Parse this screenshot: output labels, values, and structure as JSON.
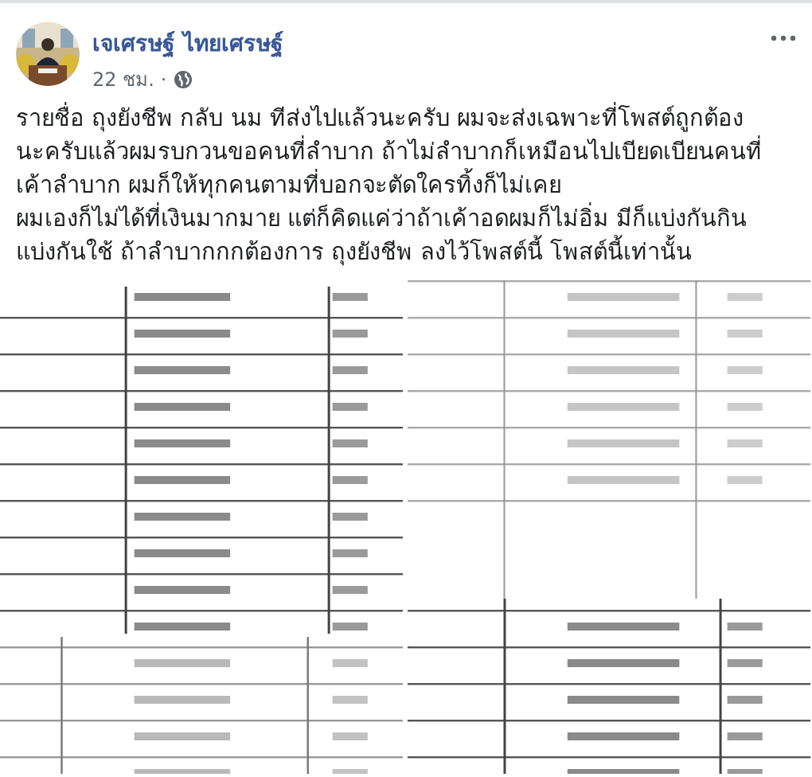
{
  "post": {
    "author": "เจเศรษฐ์ ไทยเศรษฐ์",
    "time": "22 ชม.",
    "separator": "·",
    "text": "รายชื่อ ถุงยังชีพ กลับ นม ทีส่งไปแล้วนะครับ ผมจะส่งเฉพาะที่โพสต์ถูกต้อง\nนะครับแล้วผมรบกวนขอคนที่ลำบาก ถ้าไม่ลำบากก็เหมือนไปเบียดเบียนคนที่\nเค้าลำบาก ผมก็ให้ทุกคนตามที่บอกจะตัดใครทิ้งก็ไม่เคย\nผมเองก็ไม่ได้ที่เงินมากมาย แต่ก็คิดแค่ว่าถ้าเค้าอดผมก็ไม่อิ่ม มีก็แบ่งกันกิน\nแบ่งกันใช้ ถ้าลำบากกกต้องการ ถุงยังชีพ ลงไว้โพสต์นี้ โพสต์นี้เท่านั้น"
  }
}
